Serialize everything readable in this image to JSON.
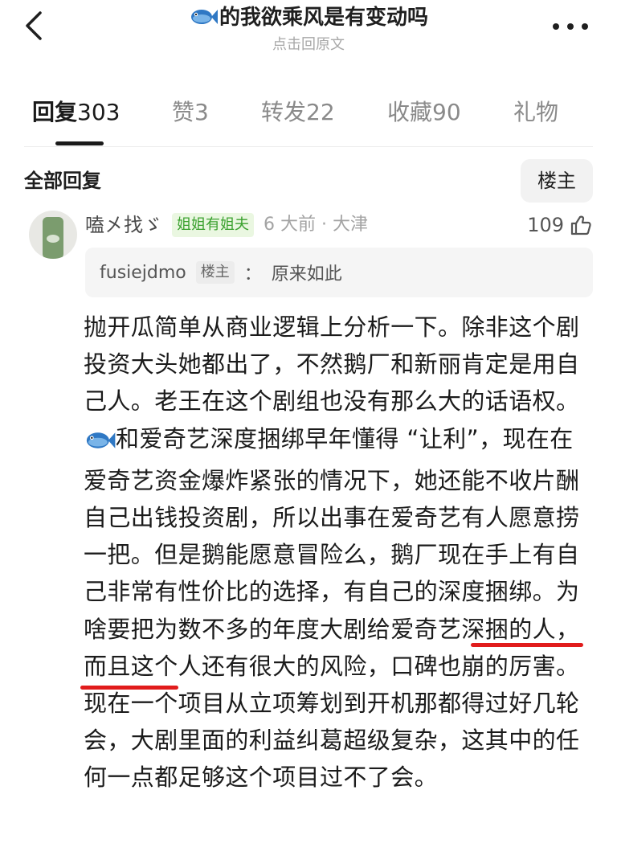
{
  "header": {
    "title": "的我欲乘风是有变动吗",
    "subtitle": "点击回原文",
    "title_icon": "fish-emoji-icon"
  },
  "tabs": [
    {
      "label": "回复",
      "count": "303",
      "active": true
    },
    {
      "label": "赞",
      "count": "3",
      "active": false
    },
    {
      "label": "转发",
      "count": "22",
      "active": false
    },
    {
      "label": "收藏",
      "count": "90",
      "active": false
    },
    {
      "label": "礼物",
      "count": "",
      "active": false
    }
  ],
  "section": {
    "title": "全部回复",
    "op_filter_label": "楼主"
  },
  "comment": {
    "username": "嗑㐅找ゞ",
    "badge": "姐姐有姐夫",
    "meta": "6 大前 · 大津",
    "like_count": "109",
    "quote": {
      "user": "fusiejdmo",
      "badge": "楼主",
      "separator": "：",
      "text": "原来如此"
    },
    "body_parts": [
      "抛开瓜简单从商业逻辑上分析一下。除非这个剧投资大头她都出了，不然鹅厂和新丽肯定是用自己人。老王在这个剧组也没有那么大的话语权。",
      "和爱奇艺深度捆绑早年懂得 “让利”，现在在爱奇艺资金爆炸紧张的情况下，她还能不收片酬自己出钱投资剧，所以出事在爱奇艺有人愿意捞一把。但是鹅能愿意冒险么，鹅厂现在手上有自己非常有性价比的选择，有自己的深度捆绑。为啥要把为数不多的年度大剧给爱奇艺深捆的人，而且这个人还有很大的风险，口碑也崩的厉害。现在一个项目从立项筹划到开机那都得过好几轮会，大剧里面的利益纠葛超级复杂，这其中的任何一点都足够这个项目过不了会。"
    ]
  },
  "colors": {
    "accent_green": "#3aa12e",
    "badge_green_bg": "#eaf7e1",
    "highlight_red": "#e11c1c",
    "muted_text": "#a3a3a3"
  }
}
